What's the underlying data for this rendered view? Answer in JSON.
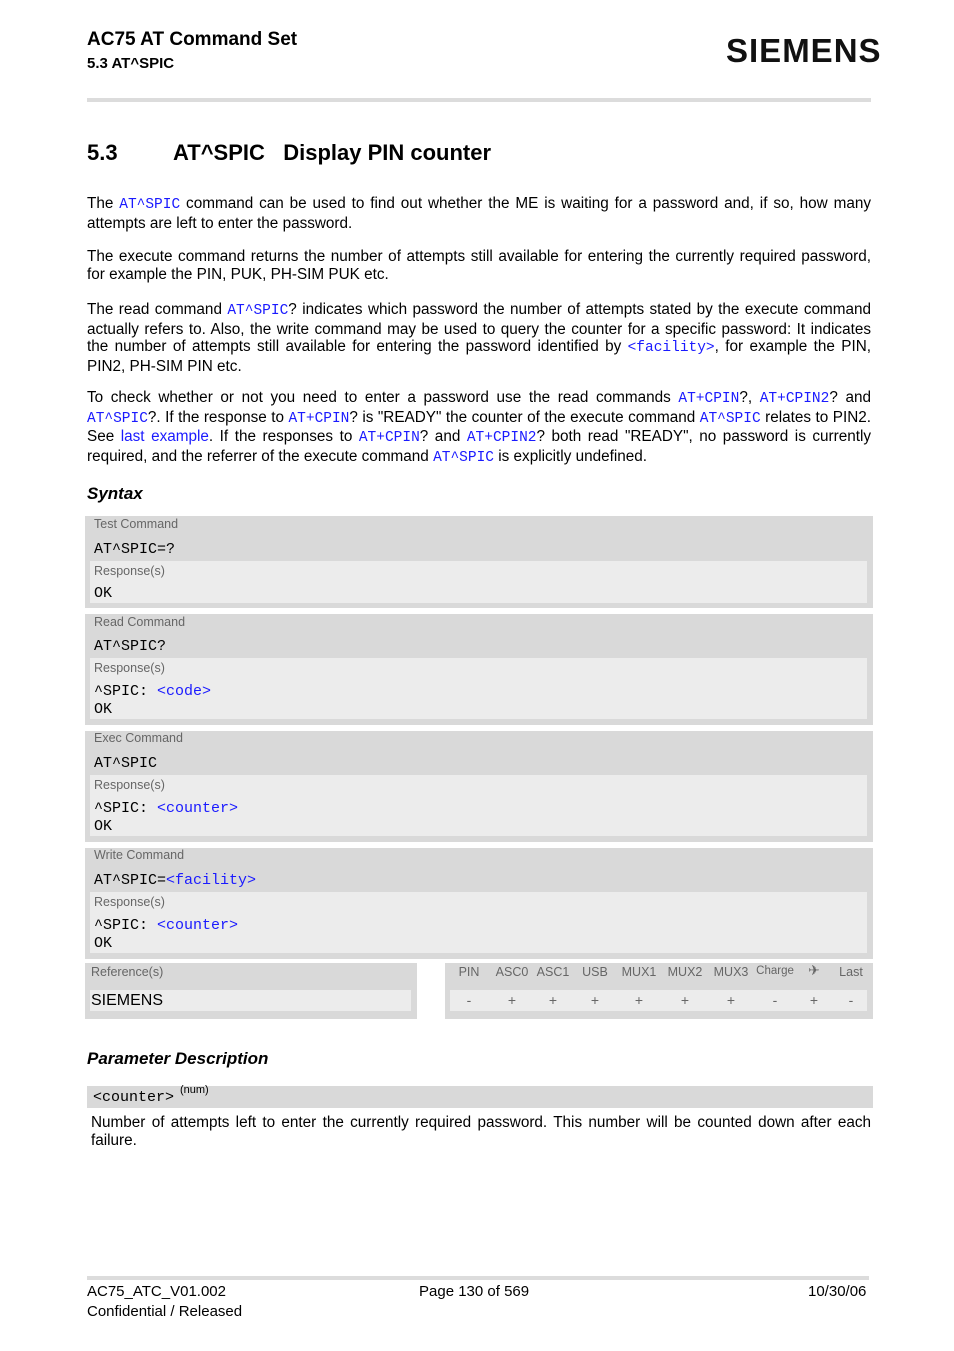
{
  "header": {
    "title": "AC75 AT Command Set",
    "subtitle": "5.3 AT^SPIC",
    "logo": "SIEMENS"
  },
  "section": {
    "number": "5.3",
    "title": "AT^SPIC   Display PIN counter"
  },
  "paragraphs": [
    [
      {
        "t": "The "
      },
      {
        "t": "AT^SPIC",
        "link": true,
        "mono": true
      },
      {
        "t": " command can be used to find out whether the ME is waiting for a password and, if so, how many attempts are left to enter the password."
      }
    ],
    [
      {
        "t": "The execute command returns the number of attempts still available for entering the currently required password, for example the PIN, PUK, PH-SIM PUK etc."
      }
    ],
    [
      {
        "t": "The read command "
      },
      {
        "t": "AT^SPIC",
        "link": true,
        "mono": true
      },
      {
        "t": "? indicates which password the number of attempts stated by the execute command actually refers to. Also, the write command may be used to query the counter for a specific password: It indicates the number of attempts still available for entering the password identified by "
      },
      {
        "t": "<facility>",
        "link": true,
        "mono": true
      },
      {
        "t": ", for example the PIN, PIN2, PH-SIM PIN etc."
      }
    ],
    [
      {
        "t": "To check whether or not you need to enter a password use the read commands "
      },
      {
        "t": "AT+CPIN",
        "link": true,
        "mono": true
      },
      {
        "t": "?, "
      },
      {
        "t": "AT+CPIN2",
        "link": true,
        "mono": true
      },
      {
        "t": "? and "
      },
      {
        "t": "AT^SPIC",
        "link": true,
        "mono": true
      },
      {
        "t": "?. If the response to "
      },
      {
        "t": "AT+CPIN",
        "link": true,
        "mono": true
      },
      {
        "t": "? is \"READY\" the counter of the execute command "
      },
      {
        "t": "AT^SPIC",
        "link": true,
        "mono": true
      },
      {
        "t": " relates to PIN2. See "
      },
      {
        "t": "last example",
        "link": true
      },
      {
        "t": ". If the responses to "
      },
      {
        "t": "AT+CPIN",
        "link": true,
        "mono": true
      },
      {
        "t": "? and "
      },
      {
        "t": "AT+CPIN2",
        "link": true,
        "mono": true
      },
      {
        "t": "? both read \"READY\", no password is currently required, and the referrer of the execute command "
      },
      {
        "t": "AT^SPIC",
        "link": true,
        "mono": true
      },
      {
        "t": " is explicitly undefined."
      }
    ]
  ],
  "syntax": {
    "heading": "Syntax",
    "blocks": [
      {
        "label": "Test Command",
        "cmd": "AT^SPIC=?",
        "cmd_param": "",
        "resp_label": "Response(s)",
        "resp_line": "OK",
        "resp_param": "",
        "resp_ok": ""
      },
      {
        "label": "Read Command",
        "cmd": "AT^SPIC?",
        "cmd_param": "",
        "resp_label": "Response(s)",
        "resp_line": "^SPIC: ",
        "resp_param": "<code>",
        "resp_ok": "OK"
      },
      {
        "label": "Exec Command",
        "cmd": "AT^SPIC",
        "cmd_param": "",
        "resp_label": "Response(s)",
        "resp_line": "^SPIC: ",
        "resp_param": "<counter>",
        "resp_ok": "OK"
      },
      {
        "label": "Write Command",
        "cmd": "AT^SPIC=",
        "cmd_param": "<facility>",
        "resp_label": "Response(s)",
        "resp_line": "^SPIC: ",
        "resp_param": "<counter>",
        "resp_ok": "OK"
      }
    ],
    "reference_label": "Reference(s)",
    "reference_value": "SIEMENS",
    "columns": [
      "PIN",
      "ASC0",
      "ASC1",
      "USB",
      "MUX1",
      "MUX2",
      "MUX3",
      "Charge",
      "airplane-icon",
      "Last"
    ],
    "values": [
      "-",
      "+",
      "+",
      "+",
      "+",
      "+",
      "+",
      "-",
      "+",
      "-"
    ]
  },
  "params": {
    "heading": "Parameter Description",
    "name": "<counter>",
    "type": "(num)",
    "description": "Number of attempts left to enter the currently required password. This number will be counted down after each failure."
  },
  "footer": {
    "doc": "AC75_ATC_V01.002",
    "status": "Confidential / Released",
    "page": "Page 130 of 569",
    "date": "10/30/06"
  },
  "colors": {
    "link": "#1a1aff",
    "block": "#d9d9d9",
    "inner": "#ececec"
  }
}
